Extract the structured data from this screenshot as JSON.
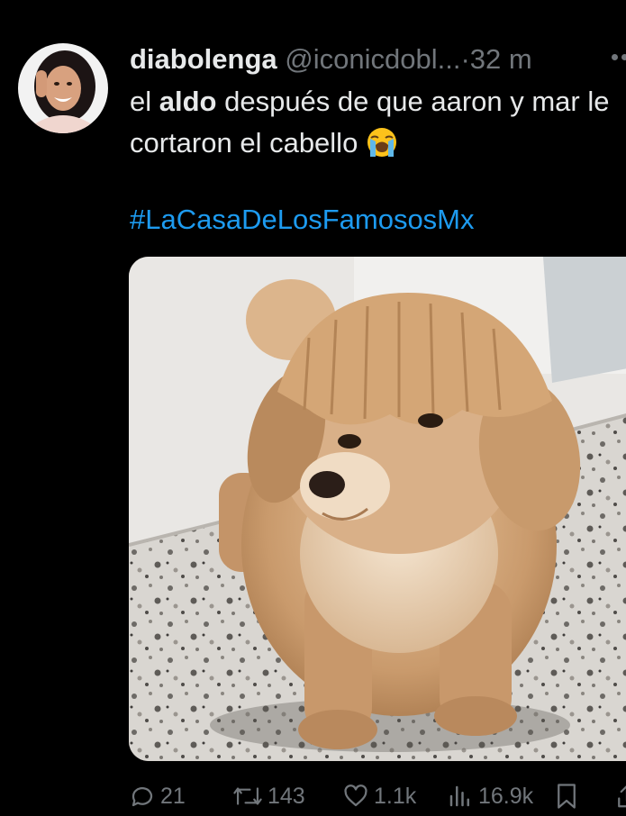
{
  "tweet": {
    "display_name": "diabolenga",
    "handle": "@iconicdobl...",
    "separator": "·",
    "time": "32 m",
    "text_part1": "el ",
    "text_bold": "aldo",
    "text_part2": " después de que aaron y mar le cortaron el cabello",
    "emoji": "loudly-crying-face",
    "hashtag": "#LaCasaDeLosFamososMx",
    "image_description_icon": "dog-with-bangs-photo"
  },
  "actions": {
    "replies": "21",
    "retweets": "143",
    "likes": "1.1k",
    "views": "16.9k"
  },
  "colors": {
    "background": "#000000",
    "text": "#e7e9ea",
    "muted": "#71767b",
    "link": "#1d9bf0"
  }
}
